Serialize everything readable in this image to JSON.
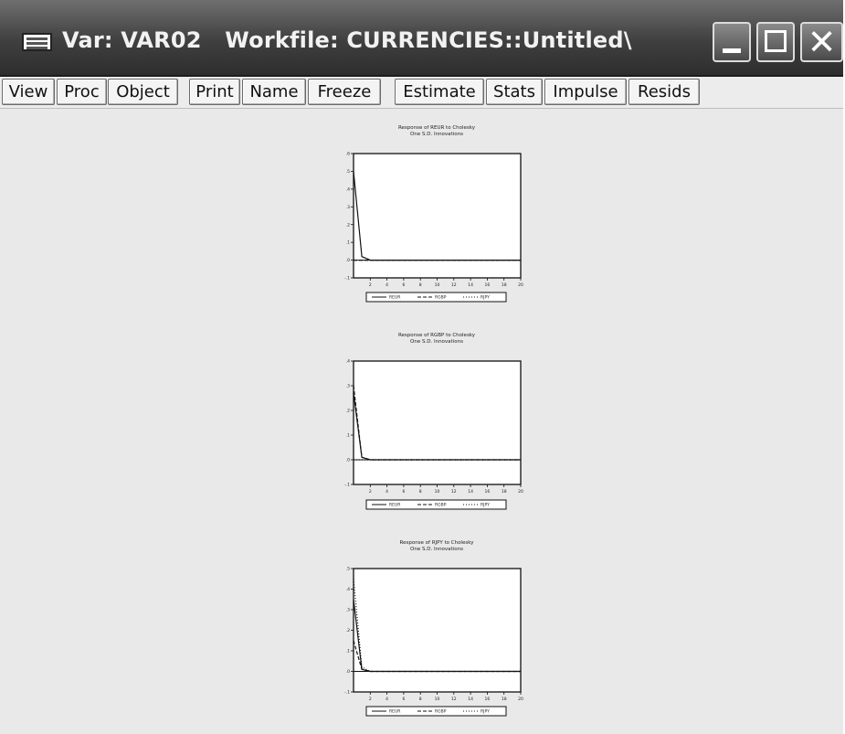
{
  "window": {
    "title": "Var: VAR02   Workfile: CURRENCIES::Untitled\\",
    "min_glyph": "_",
    "max_glyph": "□",
    "close_glyph": "✕"
  },
  "toolbar": {
    "buttons": [
      "View",
      "Proc",
      "Object",
      "Print",
      "Name",
      "Freeze",
      "Estimate",
      "Stats",
      "Impulse",
      "Resids"
    ]
  },
  "chart_data": [
    {
      "type": "line",
      "title": "Response of REUR to Cholesky\nOne S.D. Innovations",
      "x": [
        0,
        1,
        2,
        3,
        4,
        5,
        6,
        7,
        8,
        9,
        10,
        11,
        12,
        13,
        14,
        15,
        16,
        17,
        18,
        19,
        20
      ],
      "x_ticks": [
        "2",
        "4",
        "6",
        "8",
        "10",
        "12",
        "14",
        "16",
        "18",
        "20"
      ],
      "y_ticks": [
        ".6",
        ".5",
        ".4",
        ".3",
        ".2",
        ".1",
        ".0",
        "-.1"
      ],
      "ylim": [
        -0.1,
        0.6
      ],
      "series": [
        {
          "name": "REUR",
          "values": [
            0.5,
            0.02,
            0.0,
            0.0,
            0.0,
            0.0,
            0.0,
            0.0,
            0.0,
            0.0,
            0.0,
            0.0,
            0.0,
            0.0,
            0.0,
            0.0,
            0.0,
            0.0,
            0.0,
            0.0,
            0.0
          ]
        },
        {
          "name": "RGBP",
          "values": [
            0.0,
            0.0,
            0.0,
            0.0,
            0.0,
            0.0,
            0.0,
            0.0,
            0.0,
            0.0,
            0.0,
            0.0,
            0.0,
            0.0,
            0.0,
            0.0,
            0.0,
            0.0,
            0.0,
            0.0,
            0.0
          ]
        },
        {
          "name": "RJPY",
          "values": [
            0.0,
            0.0,
            0.0,
            0.0,
            0.0,
            0.0,
            0.0,
            0.0,
            0.0,
            0.0,
            0.0,
            0.0,
            0.0,
            0.0,
            0.0,
            0.0,
            0.0,
            0.0,
            0.0,
            0.0,
            0.0
          ]
        }
      ],
      "legend": "bottom"
    },
    {
      "type": "line",
      "title": "Response of RGBP to Cholesky\nOne S.D. Innovations",
      "x": [
        0,
        1,
        2,
        3,
        4,
        5,
        6,
        7,
        8,
        9,
        10,
        11,
        12,
        13,
        14,
        15,
        16,
        17,
        18,
        19,
        20
      ],
      "x_ticks": [
        "2",
        "4",
        "6",
        "8",
        "10",
        "12",
        "14",
        "16",
        "18",
        "20"
      ],
      "y_ticks": [
        ".4",
        ".3",
        ".2",
        ".1",
        ".0",
        "-.1"
      ],
      "ylim": [
        -0.1,
        0.4
      ],
      "series": [
        {
          "name": "REUR",
          "values": [
            0.27,
            0.01,
            0.0,
            0.0,
            0.0,
            0.0,
            0.0,
            0.0,
            0.0,
            0.0,
            0.0,
            0.0,
            0.0,
            0.0,
            0.0,
            0.0,
            0.0,
            0.0,
            0.0,
            0.0,
            0.0
          ]
        },
        {
          "name": "RGBP",
          "values": [
            0.3,
            0.01,
            0.0,
            0.0,
            0.0,
            0.0,
            0.0,
            0.0,
            0.0,
            0.0,
            0.0,
            0.0,
            0.0,
            0.0,
            0.0,
            0.0,
            0.0,
            0.0,
            0.0,
            0.0,
            0.0
          ]
        },
        {
          "name": "RJPY",
          "values": [
            0.0,
            0.0,
            0.0,
            0.0,
            0.0,
            0.0,
            0.0,
            0.0,
            0.0,
            0.0,
            0.0,
            0.0,
            0.0,
            0.0,
            0.0,
            0.0,
            0.0,
            0.0,
            0.0,
            0.0,
            0.0
          ]
        }
      ],
      "legend": "bottom"
    },
    {
      "type": "line",
      "title": "Response of RJPY to Cholesky\nOne S.D. Innovations",
      "x": [
        0,
        1,
        2,
        3,
        4,
        5,
        6,
        7,
        8,
        9,
        10,
        11,
        12,
        13,
        14,
        15,
        16,
        17,
        18,
        19,
        20
      ],
      "x_ticks": [
        "2",
        "4",
        "6",
        "8",
        "10",
        "12",
        "14",
        "16",
        "18",
        "20"
      ],
      "y_ticks": [
        ".5",
        ".4",
        ".3",
        ".2",
        ".1",
        ".0",
        "-.1"
      ],
      "ylim": [
        -0.1,
        0.5
      ],
      "series": [
        {
          "name": "REUR",
          "values": [
            0.35,
            0.01,
            0.0,
            0.0,
            0.0,
            0.0,
            0.0,
            0.0,
            0.0,
            0.0,
            0.0,
            0.0,
            0.0,
            0.0,
            0.0,
            0.0,
            0.0,
            0.0,
            0.0,
            0.0,
            0.0
          ]
        },
        {
          "name": "RGBP",
          "values": [
            0.15,
            0.01,
            0.0,
            0.0,
            0.0,
            0.0,
            0.0,
            0.0,
            0.0,
            0.0,
            0.0,
            0.0,
            0.0,
            0.0,
            0.0,
            0.0,
            0.0,
            0.0,
            0.0,
            0.0,
            0.0
          ]
        },
        {
          "name": "RJPY",
          "values": [
            0.45,
            0.02,
            0.0,
            0.0,
            0.0,
            0.0,
            0.0,
            0.0,
            0.0,
            0.0,
            0.0,
            0.0,
            0.0,
            0.0,
            0.0,
            0.0,
            0.0,
            0.0,
            0.0,
            0.0,
            0.0
          ]
        }
      ],
      "legend": "bottom"
    }
  ]
}
